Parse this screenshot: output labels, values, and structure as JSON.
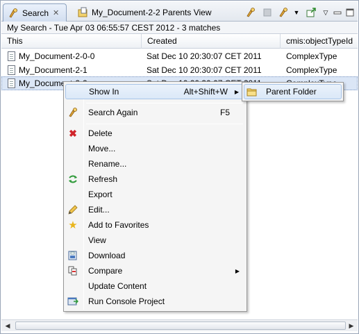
{
  "tabs": [
    {
      "label": "Search",
      "icon": "search-icon",
      "active": true
    },
    {
      "label": "My_Document-2-2 Parents View",
      "icon": "folder-view-icon",
      "active": false
    }
  ],
  "toolbar": [
    "search-again-icon",
    "stop-icon",
    "search-options-icon",
    "view-menu-icon",
    "export-icon",
    "view-menu-chevron-icon",
    "minimize-icon",
    "maximize-icon"
  ],
  "search_info": "My Search - Tue Apr 03 06:55:57 CEST 2012 - 3 matches",
  "table": {
    "columns": [
      "This",
      "Created",
      "cmis:objectTypeId"
    ],
    "rows": [
      {
        "name": "My_Document-2-0-0",
        "created": "Sat Dec 10 20:30:07 CET 2011",
        "type": "ComplexType"
      },
      {
        "name": "My_Document-2-1",
        "created": "Sat Dec 10 20:30:07 CET 2011",
        "type": "ComplexType"
      },
      {
        "name": "My_Document-2-2",
        "created": "Sat Dec 10 20:30:07 CET 2011",
        "type": "ComplexType",
        "selected": true
      }
    ]
  },
  "context_menu": {
    "items": [
      {
        "label": "Show In",
        "shortcut": "Alt+Shift+W",
        "submenu": true,
        "highlighted": true,
        "icon": ""
      },
      {
        "label": "Search Again",
        "shortcut": "F5",
        "icon": "search-again-icon"
      },
      {
        "label": "Delete",
        "icon": "delete-icon"
      },
      {
        "label": "Move...",
        "icon": ""
      },
      {
        "label": "Rename...",
        "icon": ""
      },
      {
        "label": "Refresh",
        "icon": "refresh-icon"
      },
      {
        "label": "Export",
        "icon": ""
      },
      {
        "label": "Edit...",
        "icon": "pencil-icon"
      },
      {
        "label": "Add to Favorites",
        "icon": "star-icon"
      },
      {
        "label": "View",
        "icon": ""
      },
      {
        "label": "Download",
        "icon": "download-icon"
      },
      {
        "label": "Compare",
        "submenu": true,
        "icon": "compare-icon"
      },
      {
        "label": "Update Content",
        "icon": ""
      },
      {
        "label": "Run Console Project",
        "icon": "console-icon"
      }
    ],
    "submenu": {
      "label": "Parent Folder",
      "icon": "folder-icon"
    }
  }
}
